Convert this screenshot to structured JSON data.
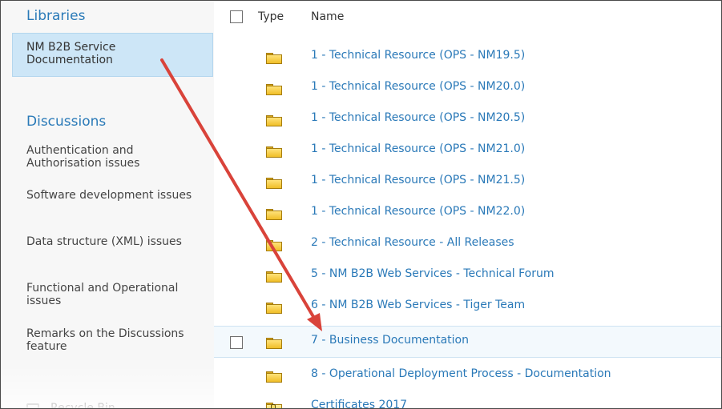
{
  "sidebar": {
    "libraries_heading": "Libraries",
    "selected_library": "NM B2B Service Documentation",
    "discussions_heading": "Discussions",
    "discussion_items": [
      "Authentication and Authorisation issues",
      "Software development issues",
      "Data structure (XML) issues",
      "Functional and Operational issues",
      "Remarks on the Discussions feature"
    ],
    "bottom_item": "Recycle Bin",
    "bottom_icon": "recycle-bin-icon"
  },
  "list": {
    "columns": [
      "Type",
      "Name"
    ],
    "rows": [
      "1 - Technical Resource (OPS - NM19.5)",
      "1 - Technical Resource (OPS - NM20.0)",
      "1 - Technical Resource (OPS - NM20.5)",
      "1 - Technical Resource (OPS - NM21.0)",
      "1 - Technical Resource (OPS - NM21.5)",
      "1 - Technical Resource (OPS - NM22.0)",
      "2 - Technical Resource - All Releases",
      "5 - NM B2B Web Services - Technical Forum",
      "6 - NM B2B Web Services - Tiger Team",
      "7 - Business Documentation",
      "8 - Operational Deployment Process - Documentation",
      "Certificates 2017"
    ],
    "selected_row": "7 - Business Documentation",
    "row_icon": "folder-icon",
    "special_icon": "certificate-folder-icon"
  },
  "colors": {
    "link": "#2a79b8",
    "selection": "#cde6f7",
    "annotation_arrow": "#d9433a"
  }
}
